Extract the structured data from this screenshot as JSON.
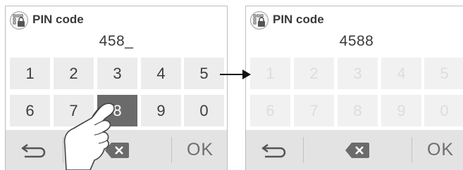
{
  "colors": {
    "key_bg": "#ececec",
    "key_pressed_bg": "#6b6b6b",
    "key_disabled_text": "#dddddd",
    "bottom_bar_bg": "#e3e3e3"
  },
  "left_panel": {
    "title": "PIN code",
    "entry": "458_",
    "icon": "keypad-lock-icon",
    "keys": [
      "1",
      "2",
      "3",
      "4",
      "5",
      "6",
      "7",
      "8",
      "9",
      "0"
    ],
    "pressed_key": "8",
    "ok_label": "OK"
  },
  "right_panel": {
    "title": "PIN code",
    "entry": "4588",
    "icon": "keypad-lock-icon",
    "keys": [
      "1",
      "2",
      "3",
      "4",
      "5",
      "6",
      "7",
      "8",
      "9",
      "0"
    ],
    "keypad_state": "disabled",
    "ok_label": "OK"
  },
  "transition_icon": "right-arrow-icon",
  "gesture_icon": "hand-pointer-icon"
}
